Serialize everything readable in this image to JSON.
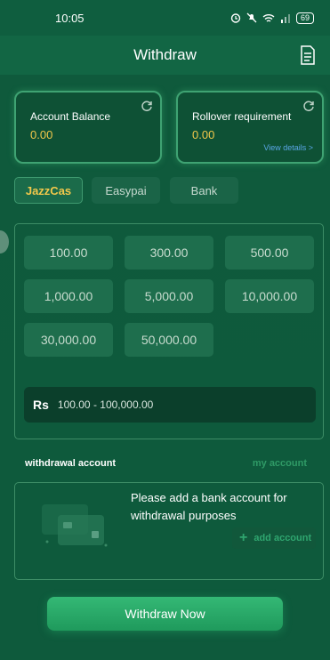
{
  "status_bar": {
    "time": "10:05",
    "battery": "69"
  },
  "header": {
    "title": "Withdraw"
  },
  "balance_card": {
    "label": "Account Balance",
    "value": "0.00"
  },
  "rollover_card": {
    "label": "Rollover requirement",
    "value": "0.00",
    "details_link": "View details >"
  },
  "tabs": [
    {
      "label": "JazzCas",
      "active": true
    },
    {
      "label": "Easypai",
      "active": false
    },
    {
      "label": "Bank",
      "active": false
    }
  ],
  "amounts": [
    "100.00",
    "300.00",
    "500.00",
    "1,000.00",
    "5,000.00",
    "10,000.00",
    "30,000.00",
    "50,000.00"
  ],
  "amount_input": {
    "currency": "Rs",
    "range_placeholder": "100.00 - 100,000.00"
  },
  "withdrawal_account": {
    "label": "withdrawal account",
    "my_account": "my account"
  },
  "account_panel": {
    "message": "Please add a bank account for withdrawal purposes",
    "add_button": "add account"
  },
  "withdraw_button": "Withdraw Now",
  "colors": {
    "accent_gold": "#f2c84b",
    "green_primary": "#1f9a5c",
    "link_blue": "#5aa6e6"
  }
}
